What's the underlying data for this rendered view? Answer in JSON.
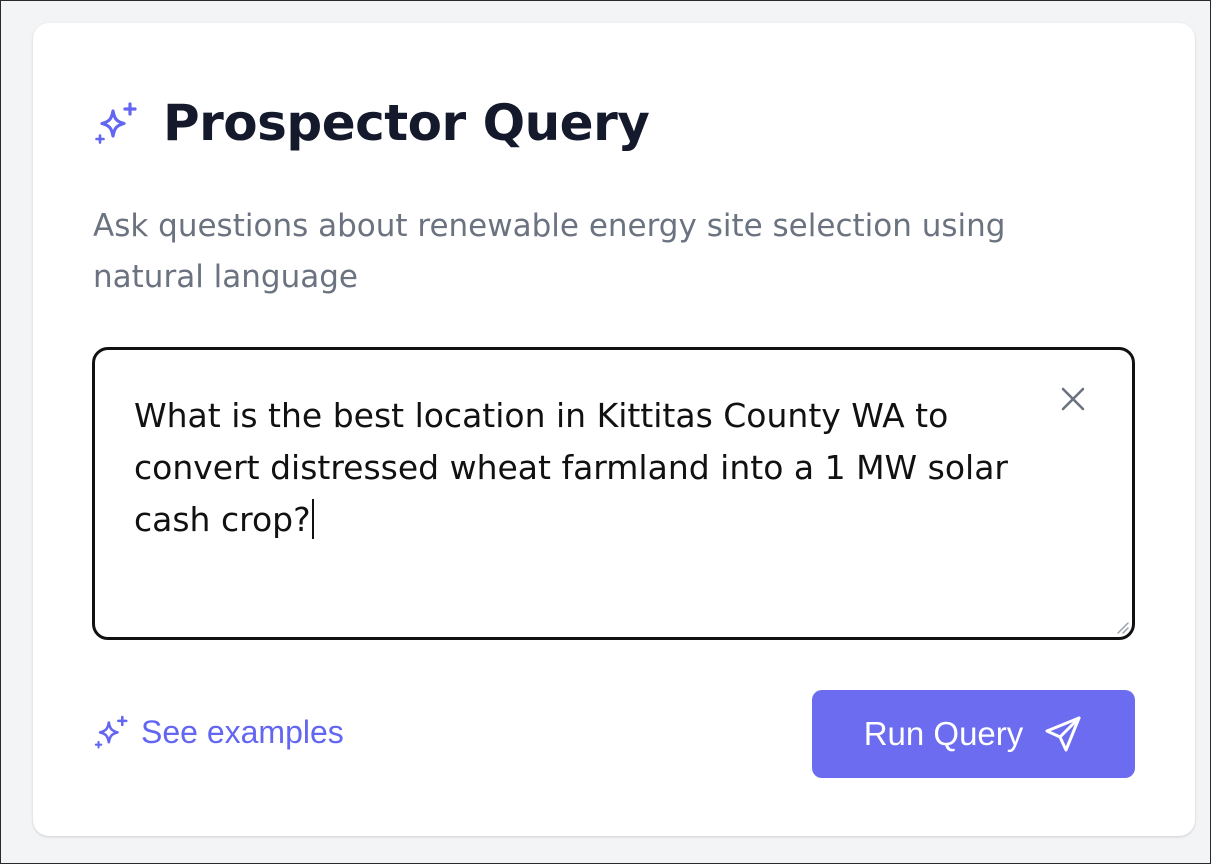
{
  "header": {
    "title": "Prospector Query",
    "icon": "sparkles-icon"
  },
  "subtitle": "Ask questions about renewable energy site selection using natural language",
  "query": {
    "value": "What is the best location in Kittitas County WA to convert distressed wheat farmland into a 1 MW solar cash crop?",
    "clear_icon": "close-icon"
  },
  "examples": {
    "label": "See examples",
    "icon": "sparkles-icon"
  },
  "run_button": {
    "label": "Run Query",
    "icon": "send-icon"
  },
  "colors": {
    "accent": "#6366f1",
    "button_bg": "#6c6cf0",
    "title": "#141a2b",
    "subtitle": "#6b7280",
    "page_bg": "#f3f4f6",
    "card_bg": "#ffffff"
  }
}
